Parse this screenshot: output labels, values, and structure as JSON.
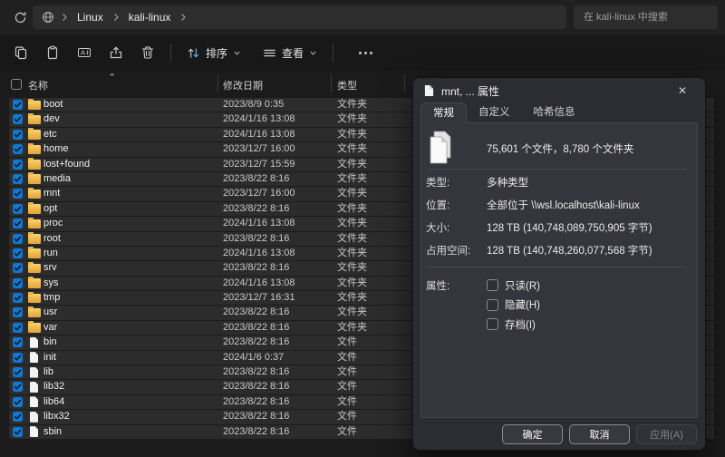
{
  "topbar": {
    "breadcrumb": [
      "Linux",
      "kali-linux"
    ],
    "search_placeholder": "在 kali-linux 中搜索"
  },
  "toolbar": {
    "sort_label": "排序",
    "view_label": "查看"
  },
  "list": {
    "columns": {
      "name": "名称",
      "date": "修改日期",
      "type": "类型"
    },
    "sort_indicator": "⌃",
    "rows": [
      {
        "name": "boot",
        "date": "2023/8/9 0:35",
        "type": "文件夹",
        "kind": "folder"
      },
      {
        "name": "dev",
        "date": "2024/1/16 13:08",
        "type": "文件夹",
        "kind": "folder"
      },
      {
        "name": "etc",
        "date": "2024/1/16 13:08",
        "type": "文件夹",
        "kind": "folder"
      },
      {
        "name": "home",
        "date": "2023/12/7 16:00",
        "type": "文件夹",
        "kind": "folder"
      },
      {
        "name": "lost+found",
        "date": "2023/12/7 15:59",
        "type": "文件夹",
        "kind": "folder"
      },
      {
        "name": "media",
        "date": "2023/8/22 8:16",
        "type": "文件夹",
        "kind": "folder"
      },
      {
        "name": "mnt",
        "date": "2023/12/7 16:00",
        "type": "文件夹",
        "kind": "folder"
      },
      {
        "name": "opt",
        "date": "2023/8/22 8:16",
        "type": "文件夹",
        "kind": "folder"
      },
      {
        "name": "proc",
        "date": "2024/1/16 13:08",
        "type": "文件夹",
        "kind": "folder"
      },
      {
        "name": "root",
        "date": "2023/8/22 8:16",
        "type": "文件夹",
        "kind": "folder"
      },
      {
        "name": "run",
        "date": "2024/1/16 13:08",
        "type": "文件夹",
        "kind": "folder"
      },
      {
        "name": "srv",
        "date": "2023/8/22 8:16",
        "type": "文件夹",
        "kind": "folder"
      },
      {
        "name": "sys",
        "date": "2024/1/16 13:08",
        "type": "文件夹",
        "kind": "folder"
      },
      {
        "name": "tmp",
        "date": "2023/12/7 16:31",
        "type": "文件夹",
        "kind": "folder"
      },
      {
        "name": "usr",
        "date": "2023/8/22 8:16",
        "type": "文件夹",
        "kind": "folder"
      },
      {
        "name": "var",
        "date": "2023/8/22 8:16",
        "type": "文件夹",
        "kind": "folder"
      },
      {
        "name": "bin",
        "date": "2023/8/22 8:16",
        "type": "文件",
        "kind": "file"
      },
      {
        "name": "init",
        "date": "2024/1/6 0:37",
        "type": "文件",
        "kind": "file"
      },
      {
        "name": "lib",
        "date": "2023/8/22 8:16",
        "type": "文件",
        "kind": "file"
      },
      {
        "name": "lib32",
        "date": "2023/8/22 8:16",
        "type": "文件",
        "kind": "file"
      },
      {
        "name": "lib64",
        "date": "2023/8/22 8:16",
        "type": "文件",
        "kind": "file"
      },
      {
        "name": "libx32",
        "date": "2023/8/22 8:16",
        "type": "文件",
        "kind": "file"
      },
      {
        "name": "sbin",
        "date": "2023/8/22 8:16",
        "type": "文件",
        "kind": "file"
      }
    ]
  },
  "dialog": {
    "title": "mnt, ... 属性",
    "close_glyph": "✕",
    "tabs": [
      {
        "label": "常规",
        "active": true
      },
      {
        "label": "自定义",
        "active": false
      },
      {
        "label": "哈希信息",
        "active": false
      }
    ],
    "summary": "75,601 个文件，8,780 个文件夹",
    "fields": [
      {
        "label": "类型:",
        "value": "多种类型"
      },
      {
        "label": "位置:",
        "value": "全部位于 \\\\wsl.localhost\\kali-linux"
      },
      {
        "label": "大小:",
        "value": "128 TB (140,748,089,750,905 字节)"
      },
      {
        "label": "占用空间:",
        "value": "128 TB (140,748,260,077,568 字节)"
      }
    ],
    "attributes_label": "属性:",
    "attributes": [
      {
        "label": "只读(R)",
        "checked": false
      },
      {
        "label": "隐藏(H)",
        "checked": false
      },
      {
        "label": "存档(I)",
        "checked": false
      }
    ],
    "buttons": [
      {
        "label": "确定",
        "name": "ok-button",
        "enabled": true
      },
      {
        "label": "取消",
        "name": "cancel-button",
        "enabled": true
      },
      {
        "label": "应用(A)",
        "name": "apply-button",
        "enabled": false
      }
    ]
  },
  "colors": {
    "checkbox_accent": "#0f78d4",
    "folder_icon": "#f0bc4e",
    "row_selection": "#2c2c2c",
    "dialog_bg": "#2c2c33"
  }
}
